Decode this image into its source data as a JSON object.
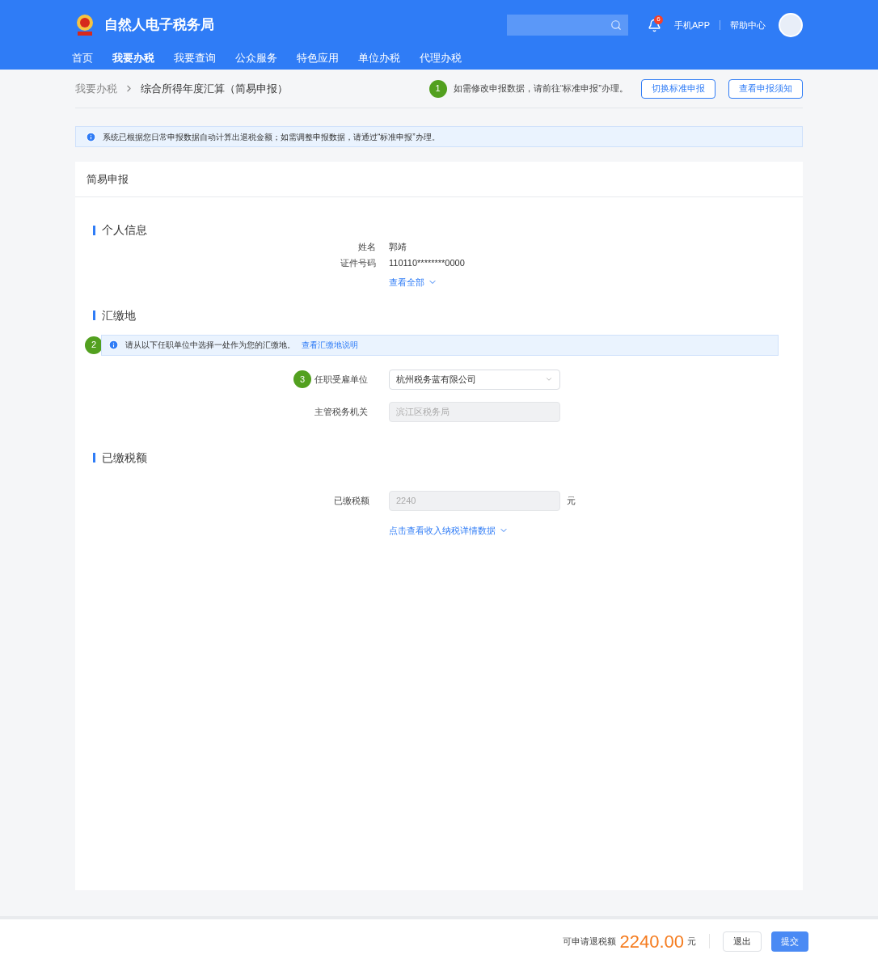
{
  "header": {
    "title": "自然人电子税务局",
    "notification_count": "6",
    "links": [
      "手机APP",
      "帮助中心"
    ]
  },
  "nav": [
    {
      "label": "首页",
      "selected": false
    },
    {
      "label": "我要办税",
      "selected": true
    },
    {
      "label": "我要查询",
      "selected": false
    },
    {
      "label": "公众服务",
      "selected": false
    },
    {
      "label": "特色应用",
      "selected": false
    },
    {
      "label": "单位办税",
      "selected": false
    },
    {
      "label": "代理办税",
      "selected": false
    }
  ],
  "breadcrumb": {
    "parent": "我要办税",
    "current": "综合所得年度汇算（简易申报）"
  },
  "tip": {
    "step": "1",
    "text": "如需修改申报数据，请前往“标准申报”办理。"
  },
  "actions": [
    "切换标准申报",
    "查看申报须知"
  ],
  "notice": "系统已根据您日常申报数据自动计算出退税金额；如需调整申报数据，请通过“标准申报”办理。",
  "card_title": "简易申报",
  "personal": {
    "heading": "个人信息",
    "fields": [
      {
        "label": "姓名",
        "value": "郭靖"
      },
      {
        "label": "证件号码",
        "value": "110110********0000"
      }
    ],
    "more": "查看全部"
  },
  "place": {
    "heading": "汇缴地",
    "step": "2",
    "notice": "请从以下任职单位中选择一处作为您的汇缴地。",
    "notice_link": "查看汇缴地说明",
    "employer": {
      "step": "3",
      "label": "任职受雇单位",
      "value": "杭州税务蓝有限公司"
    },
    "authority": {
      "label": "主管税务机关",
      "value": "滨江区税务局"
    }
  },
  "paid": {
    "heading": "已缴税额",
    "label": "已缴税额",
    "value": "2240",
    "unit": "元",
    "more": "点击查看收入纳税详情数据"
  },
  "footer": {
    "label": "可申请退税额",
    "amount": "2240.00",
    "unit": "元",
    "buttons": [
      "退出",
      "提交"
    ]
  }
}
